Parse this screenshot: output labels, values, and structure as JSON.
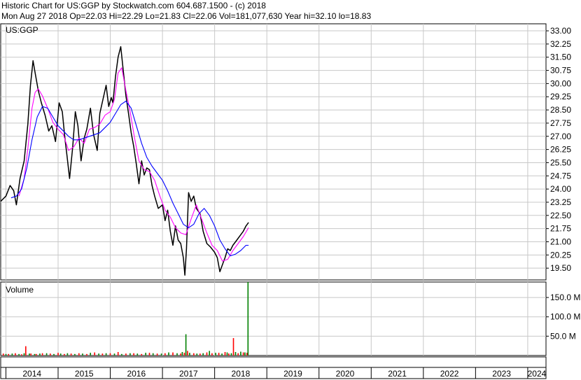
{
  "header": {
    "line1": "Historic Chart for US:GGP by Stockwatch.com 604.687.1500 - (c) 2018",
    "line2": "Mon Aug 27 2018   Op=22.03   Hi=22.29   Lo=21.83   Cl=22.06   Vol=181,077,630   Year hi=32.10   lo=18.83"
  },
  "chart_data": [
    {
      "type": "line",
      "title": "US:GGP",
      "xlabel": "",
      "ylabel": "",
      "ylim": [
        18.83,
        33.4
      ],
      "xlim": [
        2013.9,
        2024.35
      ],
      "y_ticks": [
        "33.00",
        "32.25",
        "31.50",
        "30.75",
        "30.00",
        "29.25",
        "28.50",
        "27.75",
        "27.00",
        "26.25",
        "25.50",
        "24.75",
        "24.00",
        "23.25",
        "22.50",
        "21.75",
        "21.00",
        "20.25",
        "19.50"
      ],
      "x_ticks": [
        "2014",
        "2015",
        "2016",
        "2017",
        "2018",
        "2019",
        "2020",
        "2021",
        "2022",
        "2023",
        "2024"
      ],
      "grid": true,
      "series": [
        {
          "name": "",
          "color": "#000000",
          "x": [
            2013.9,
            2014.0,
            2014.08,
            2014.15,
            2014.2,
            2014.27,
            2014.35,
            2014.42,
            2014.47,
            2014.52,
            2014.56,
            2014.62,
            2014.68,
            2014.75,
            2014.82,
            2014.88,
            2014.95,
            2015.02,
            2015.08,
            2015.13,
            2015.17,
            2015.22,
            2015.28,
            2015.33,
            2015.38,
            2015.44,
            2015.5,
            2015.55,
            2015.62,
            2015.68,
            2015.75,
            2015.8,
            2015.86,
            2015.92,
            2015.97,
            2016.02,
            2016.05,
            2016.1,
            2016.15,
            2016.2,
            2016.25,
            2016.3,
            2016.35,
            2016.4,
            2016.45,
            2016.5,
            2016.55,
            2016.6,
            2016.65,
            2016.7,
            2016.75,
            2016.8,
            2016.85,
            2016.92,
            2017.0,
            2017.05,
            2017.1,
            2017.15,
            2017.2,
            2017.25,
            2017.3,
            2017.35,
            2017.4,
            2017.43,
            2017.46,
            2017.5,
            2017.55,
            2017.6,
            2017.65,
            2017.72,
            2017.78,
            2017.85,
            2017.92,
            2018.0,
            2018.05,
            2018.1,
            2018.15,
            2018.2,
            2018.25,
            2018.3,
            2018.35,
            2018.4,
            2018.45,
            2018.5,
            2018.55,
            2018.6,
            2018.65
          ],
          "y": [
            23.3,
            23.6,
            24.2,
            23.9,
            23.1,
            24.6,
            25.6,
            27.7,
            29.9,
            31.3,
            30.6,
            29.6,
            28.9,
            28.2,
            27.3,
            27.6,
            26.7,
            28.9,
            28.4,
            26.9,
            25.9,
            24.6,
            26.4,
            28.4,
            27.6,
            25.6,
            26.9,
            27.4,
            28.6,
            27.1,
            26.2,
            28.3,
            29.1,
            29.9,
            28.7,
            29.2,
            28.9,
            30.4,
            31.5,
            32.1,
            30.7,
            29.3,
            28.3,
            27.2,
            26.4,
            25.4,
            24.3,
            25.6,
            24.8,
            25.2,
            25.1,
            24.2,
            23.6,
            22.9,
            23.1,
            22.2,
            22.8,
            21.6,
            20.8,
            21.9,
            21.1,
            20.9,
            20.1,
            19.1,
            20.6,
            23.8,
            23.3,
            23.6,
            22.9,
            22.6,
            21.6,
            20.9,
            20.7,
            20.4,
            20.1,
            19.3,
            19.7,
            20.1,
            20.6,
            20.5,
            20.8,
            21.0,
            21.2,
            21.4,
            21.6,
            21.9,
            22.1
          ]
        },
        {
          "name": "",
          "color": "#ff00ff",
          "x": [
            2014.25,
            2014.35,
            2014.42,
            2014.5,
            2014.56,
            2014.62,
            2014.7,
            2014.8,
            2014.9,
            2015.0,
            2015.1,
            2015.2,
            2015.3,
            2015.4,
            2015.5,
            2015.6,
            2015.7,
            2015.8,
            2015.9,
            2016.0,
            2016.08,
            2016.15,
            2016.22,
            2016.3,
            2016.38,
            2016.46,
            2016.55,
            2016.65,
            2016.75,
            2016.85,
            2016.95,
            2017.05,
            2017.15,
            2017.25,
            2017.35,
            2017.45,
            2017.55,
            2017.65,
            2017.75,
            2017.85,
            2017.95,
            2018.05,
            2018.15,
            2018.25,
            2018.35,
            2018.45,
            2018.55,
            2018.65
          ],
          "y": [
            23.6,
            24.6,
            26.3,
            28.6,
            29.5,
            29.7,
            29.3,
            28.6,
            27.8,
            27.4,
            27.1,
            26.2,
            26.4,
            26.9,
            26.6,
            27.4,
            27.5,
            27.7,
            28.2,
            28.4,
            29.1,
            30.6,
            30.9,
            29.6,
            28.4,
            27.0,
            25.6,
            25.1,
            25.0,
            24.5,
            23.6,
            22.8,
            22.4,
            21.8,
            21.5,
            21.4,
            22.3,
            23.1,
            22.3,
            21.5,
            20.8,
            20.5,
            19.9,
            20.0,
            20.5,
            20.9,
            21.3,
            21.8
          ]
        },
        {
          "name": "",
          "color": "#0000ff",
          "x": [
            2014.1,
            2014.2,
            2014.3,
            2014.4,
            2014.5,
            2014.6,
            2014.7,
            2014.8,
            2014.9,
            2015.0,
            2015.1,
            2015.2,
            2015.3,
            2015.4,
            2015.5,
            2015.6,
            2015.7,
            2015.8,
            2015.9,
            2016.0,
            2016.1,
            2016.2,
            2016.3,
            2016.4,
            2016.5,
            2016.6,
            2016.7,
            2016.8,
            2016.9,
            2017.0,
            2017.1,
            2017.2,
            2017.3,
            2017.4,
            2017.5,
            2017.6,
            2017.7,
            2017.8,
            2017.9,
            2018.0,
            2018.1,
            2018.2,
            2018.3,
            2018.4,
            2018.5,
            2018.6,
            2018.65
          ],
          "y": [
            23.5,
            23.6,
            24.0,
            25.2,
            26.8,
            28.1,
            28.7,
            28.6,
            28.1,
            27.6,
            27.3,
            27.0,
            26.8,
            26.8,
            26.9,
            27.0,
            27.1,
            27.2,
            27.5,
            27.8,
            28.3,
            28.8,
            29.0,
            28.6,
            27.6,
            26.6,
            25.8,
            25.3,
            24.9,
            24.5,
            23.9,
            23.2,
            22.6,
            22.0,
            21.8,
            22.0,
            22.6,
            22.9,
            22.5,
            21.9,
            21.1,
            20.6,
            20.2,
            20.3,
            20.5,
            20.8,
            20.8
          ]
        }
      ]
    },
    {
      "type": "bar",
      "title": "Volume",
      "xlabel": "",
      "ylabel": "",
      "ylim": [
        0,
        190
      ],
      "y_ticks": [
        "150.0 M",
        "100.0 M",
        "50.0 M"
      ],
      "grid": true,
      "series": [
        {
          "name": "",
          "color": "#ff0000",
          "x": [
            2013.95,
            2014.05,
            2014.18,
            2014.3,
            2014.38,
            2014.48,
            2014.58,
            2014.7,
            2014.85,
            2015.0,
            2015.12,
            2015.25,
            2015.4,
            2015.55,
            2015.7,
            2015.85,
            2016.0,
            2016.15,
            2016.3,
            2016.45,
            2016.6,
            2016.75,
            2016.9,
            2017.05,
            2017.2,
            2017.35,
            2017.42,
            2017.48,
            2017.6,
            2017.72,
            2017.85,
            2017.95,
            2018.08,
            2018.2,
            2018.27,
            2018.36,
            2018.45,
            2018.55,
            2018.62
          ],
          "values": [
            5,
            4,
            6,
            3,
            24,
            5,
            4,
            6,
            5,
            7,
            4,
            5,
            6,
            4,
            8,
            5,
            6,
            9,
            5,
            6,
            4,
            7,
            5,
            6,
            8,
            5,
            7,
            12,
            6,
            5,
            8,
            6,
            7,
            9,
            5,
            45,
            6,
            8,
            7
          ]
        },
        {
          "name": "",
          "color": "#008000",
          "x": [
            2014.0,
            2014.12,
            2014.25,
            2014.35,
            2014.45,
            2014.55,
            2014.65,
            2014.78,
            2014.92,
            2015.05,
            2015.18,
            2015.32,
            2015.47,
            2015.62,
            2015.78,
            2015.92,
            2016.08,
            2016.22,
            2016.38,
            2016.52,
            2016.68,
            2016.82,
            2016.98,
            2017.12,
            2017.28,
            2017.38,
            2017.45,
            2017.52,
            2017.66,
            2017.78,
            2017.9,
            2018.02,
            2018.14,
            2018.24,
            2018.32,
            2018.4,
            2018.5,
            2018.58,
            2018.64
          ],
          "values": [
            4,
            5,
            4,
            6,
            5,
            4,
            5,
            6,
            4,
            5,
            6,
            4,
            5,
            7,
            5,
            6,
            5,
            4,
            6,
            5,
            7,
            6,
            5,
            8,
            6,
            9,
            55,
            7,
            5,
            6,
            12,
            7,
            5,
            8,
            6,
            9,
            10,
            8,
            190
          ]
        }
      ]
    }
  ]
}
